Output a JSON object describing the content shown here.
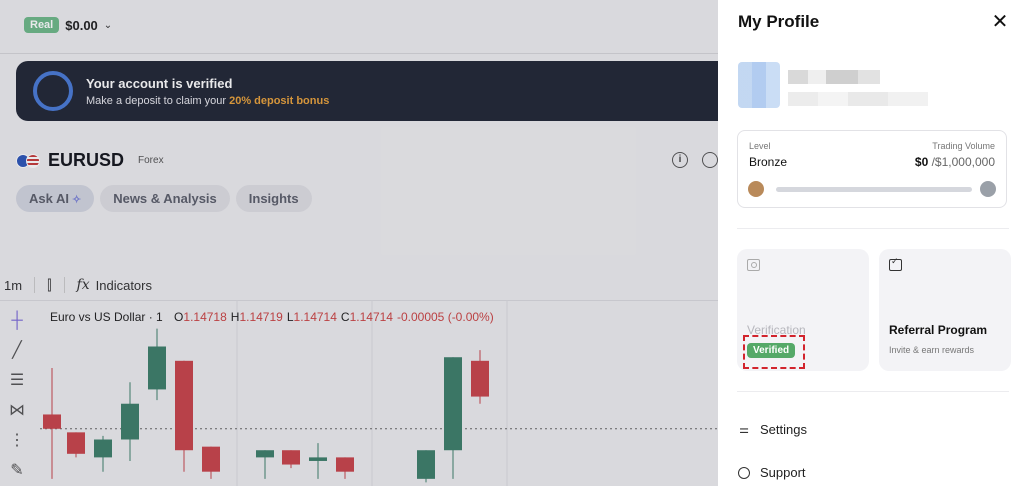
{
  "account": {
    "mode_badge": "Real",
    "balance": "$0.00"
  },
  "banner": {
    "title": "Your account is verified",
    "subtitle_prefix": "Make a deposit to claim your ",
    "subtitle_highlight": "20% deposit bonus"
  },
  "instrument": {
    "symbol": "EURUSD",
    "category": "Forex"
  },
  "tabs": [
    {
      "label": "Ask AI"
    },
    {
      "label": "News & Analysis"
    },
    {
      "label": "Insights"
    }
  ],
  "chart_toolbar": {
    "timeframe": "1m",
    "indicators_label": "Indicators"
  },
  "legend": {
    "title": "Euro vs US Dollar · 1",
    "open_label": "O",
    "open": "1.14718",
    "high_label": "H",
    "high": "1.14719",
    "low_label": "L",
    "low": "1.14714",
    "close_label": "C",
    "close": "1.14714",
    "change": "-0.00005 (-0.00%)"
  },
  "chart_data": {
    "type": "candlestick",
    "candles": [
      {
        "o": 1.14718,
        "h": 1.14731,
        "l": 1.147,
        "c": 1.14714,
        "dir": "down"
      },
      {
        "o": 1.14713,
        "h": 1.14713,
        "l": 1.14706,
        "c": 1.14707,
        "dir": "down"
      },
      {
        "o": 1.14706,
        "h": 1.14712,
        "l": 1.14702,
        "c": 1.14711,
        "dir": "up"
      },
      {
        "o": 1.14711,
        "h": 1.14727,
        "l": 1.14705,
        "c": 1.14721,
        "dir": "up"
      },
      {
        "o": 1.14725,
        "h": 1.14742,
        "l": 1.14722,
        "c": 1.14737,
        "dir": "up"
      },
      {
        "o": 1.14733,
        "h": 1.14733,
        "l": 1.14702,
        "c": 1.14708,
        "dir": "down"
      },
      {
        "o": 1.14709,
        "h": 1.14709,
        "l": 1.147,
        "c": 1.14702,
        "dir": "down"
      },
      {
        "o": 1.14706,
        "h": 1.14708,
        "l": 1.147,
        "c": 1.14708,
        "dir": "up"
      },
      {
        "o": 1.14708,
        "h": 1.14708,
        "l": 1.14703,
        "c": 1.14704,
        "dir": "down"
      },
      {
        "o": 1.14705,
        "h": 1.1471,
        "l": 1.147,
        "c": 1.14706,
        "dir": "up"
      },
      {
        "o": 1.14706,
        "h": 1.14706,
        "l": 1.147,
        "c": 1.14702,
        "dir": "down"
      },
      {
        "o": 1.147,
        "h": 1.14708,
        "l": 1.14699,
        "c": 1.14708,
        "dir": "up"
      },
      {
        "o": 1.14708,
        "h": 1.14734,
        "l": 1.147,
        "c": 1.14734,
        "dir": "up"
      },
      {
        "o": 1.14733,
        "h": 1.14736,
        "l": 1.14721,
        "c": 1.14723,
        "dir": "down"
      }
    ],
    "current_price": 1.14714,
    "colors": {
      "up": "#3e7f6a",
      "down": "#c9444b"
    }
  },
  "profile": {
    "title": "My Profile",
    "level_label": "Level",
    "level": "Bronze",
    "volume_label": "Trading Volume",
    "volume": "$0",
    "volume_max": " /$1,000,000",
    "progress_fraction": 0.0,
    "verification_card": {
      "title": "Verification",
      "status": "Verified"
    },
    "referral_card": {
      "title": "Referral Program",
      "subtitle": "Invite & earn rewards"
    },
    "menu": [
      {
        "label": "Settings"
      },
      {
        "label": "Support"
      }
    ]
  },
  "icons": {
    "close": "close-icon",
    "info": "info-icon",
    "alarm": "alarm-clock-icon",
    "candles": "candles-icon",
    "fx": "fx-icon",
    "settings": "sliders-icon",
    "support": "lifebuoy-icon"
  }
}
